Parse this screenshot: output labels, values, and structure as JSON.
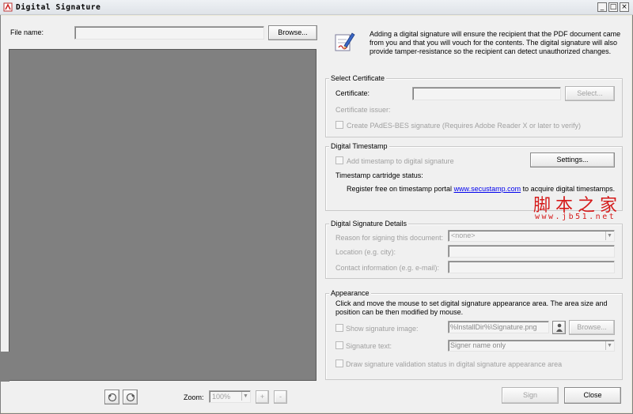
{
  "window": {
    "title": "Digital Signature",
    "minimize_glyph": "_",
    "maximize_glyph": "□",
    "close_glyph": "×"
  },
  "file": {
    "label": "File name:",
    "value": "",
    "browse_label": "Browse..."
  },
  "info": {
    "icon": "pen-signature-icon",
    "text": "Adding a digital signature will ensure the recipient that the PDF document came from you and that you will vouch for the contents. The digital signature will also provide tamper-resistance so the recipient can detect unauthorized changes."
  },
  "select_certificate": {
    "title": "Select Certificate",
    "certificate_label": "Certificate:",
    "certificate_value": "",
    "select_label": "Select...",
    "issuer_label": "Certificate issuer:",
    "pades_label": "Create PAdES-BES signature (Requires Adobe Reader X or later to verify)"
  },
  "timestamp": {
    "title": "Digital Timestamp",
    "add_label": "Add timestamp to digital signature",
    "settings_label": "Settings...",
    "status_label": "Timestamp cartridge status:",
    "register_prefix": "Register free on timestamp portal ",
    "register_link": "www.secustamp.com",
    "register_suffix": " to acquire digital timestamps."
  },
  "details": {
    "title": "Digital Signature Details",
    "reason_label": "Reason for signing this document:",
    "reason_value": "<none>",
    "location_label": "Location (e.g. city):",
    "location_value": "",
    "contact_label": "Contact information (e.g. e-mail):",
    "contact_value": ""
  },
  "appearance": {
    "title": "Appearance",
    "instructions": "Click and move the mouse to set digital signature appearance area. The area size and position can be then modified by mouse.",
    "show_image_label": "Show signature image:",
    "image_path": "%InstallDir%\\Signature.png",
    "browse_label": "Browse...",
    "signature_text_label": "Signature text:",
    "signature_text_value": "Signer name only",
    "draw_status_label": "Draw signature validation status in digital signature appearance area"
  },
  "footer": {
    "rotate_left_icon": "rotate-left-icon",
    "rotate_right_icon": "rotate-right-icon",
    "zoom_label": "Zoom:",
    "zoom_value": "100%",
    "zoom_in": "+",
    "zoom_out": "-",
    "sign_label": "Sign",
    "close_label": "Close"
  },
  "watermark": {
    "cn_text": "脚本之家",
    "url_text": "www.jb51.net"
  },
  "colors": {
    "preview_bg": "#808080",
    "link": "#0000ee",
    "watermark": "#d51a1a"
  }
}
